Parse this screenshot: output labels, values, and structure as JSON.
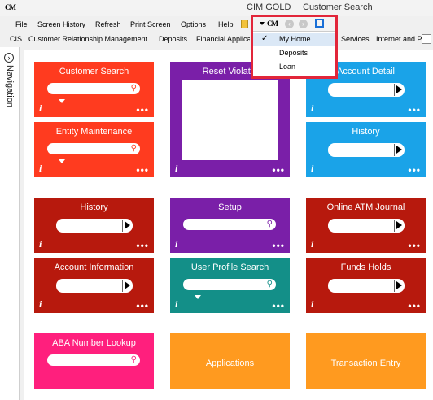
{
  "window": {
    "logo": "CM",
    "app_title": "CIM GOLD",
    "page_title": "Customer Search"
  },
  "menu": [
    {
      "label": "File",
      "mnemonic": "F"
    },
    {
      "label": "Screen History",
      "mnemonic": "S"
    },
    {
      "label": "Refresh",
      "mnemonic": "R"
    },
    {
      "label": "Print Screen",
      "mnemonic": "P"
    },
    {
      "label": "Options",
      "mnemonic": "O"
    },
    {
      "label": "Help",
      "mnemonic": "H"
    }
  ],
  "nav": [
    "CIS",
    "Customer Relationship Management",
    "Deposits",
    "Financial Applicati",
    "Services",
    "Internet and Pho"
  ],
  "sidebar": {
    "label": "Navigation",
    "toggle": "›"
  },
  "dropdown": {
    "logo": "CM",
    "items": [
      {
        "label": "My Home",
        "checked": true,
        "check": "✓"
      },
      {
        "label": "Deposits",
        "checked": false,
        "check": ""
      },
      {
        "label": "Loan",
        "checked": false,
        "check": ""
      }
    ]
  },
  "tiles": {
    "customer_search": {
      "title": "Customer Search",
      "color": "#ff3b1f"
    },
    "entity_maintenance": {
      "title": "Entity Maintenance",
      "color": "#ff3b1f"
    },
    "reset_violations": {
      "title": "Reset Violatio",
      "color": "#7a1fa8"
    },
    "account_detail": {
      "title": "Account Detail",
      "color": "#1aa3e8"
    },
    "history_blue": {
      "title": "History",
      "color": "#1aa3e8"
    },
    "history_red": {
      "title": "History",
      "color": "#b7190d"
    },
    "account_information": {
      "title": "Account Information",
      "color": "#b7190d"
    },
    "setup": {
      "title": "Setup",
      "color": "#7a1fa8"
    },
    "user_profile_search": {
      "title": "User Profile Search",
      "color": "#138f88"
    },
    "online_atm_journal": {
      "title": "Online ATM Journal",
      "color": "#b7190d"
    },
    "funds_holds": {
      "title": "Funds Holds",
      "color": "#b7190d"
    },
    "aba_number_lookup": {
      "title": "ABA Number Lookup",
      "color": "#ff1f7d"
    },
    "applications": {
      "title": "Applications",
      "color": "#ff9a1f"
    },
    "transaction_entry": {
      "title": "Transaction Entry",
      "color": "#ff9a1f"
    }
  },
  "common": {
    "info": "i",
    "more": "•••",
    "mag": "⚲"
  },
  "colors": {
    "highlight_border": "#e2263a"
  }
}
